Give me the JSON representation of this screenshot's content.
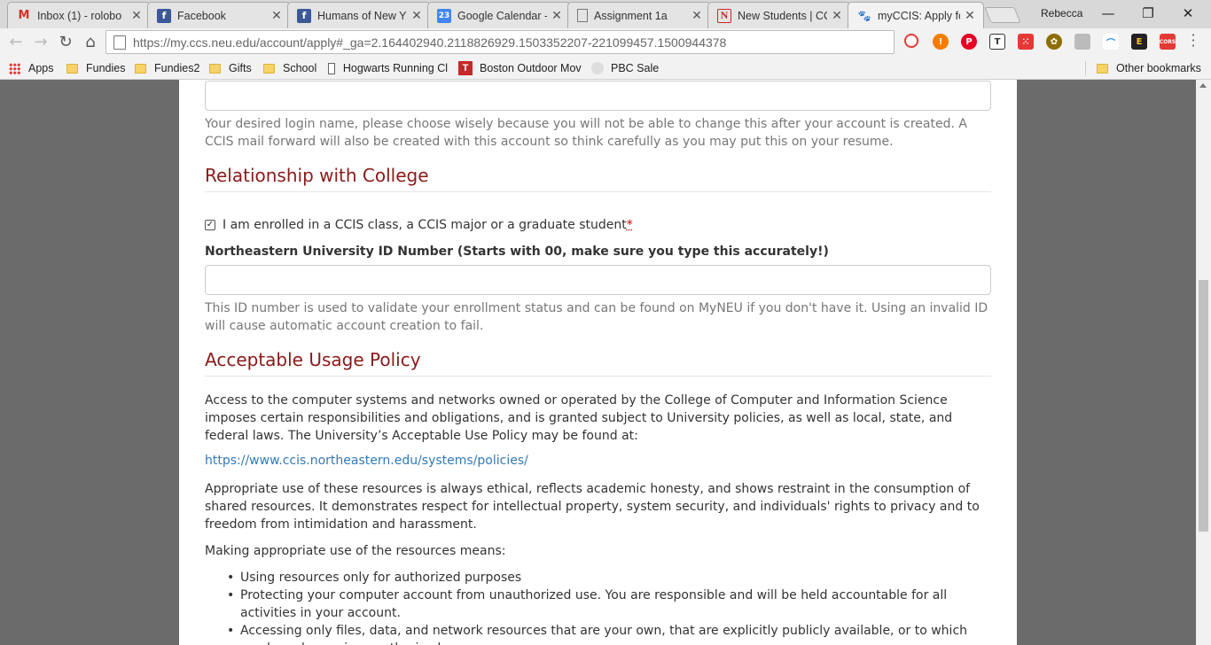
{
  "browser": {
    "tabs": [
      {
        "title": "Inbox (1) - rolobo",
        "icon": "gmail-icon",
        "color": "#d93025",
        "glyph": "M"
      },
      {
        "title": "Facebook",
        "icon": "facebook-icon",
        "color": "#3b5998",
        "glyph": "f"
      },
      {
        "title": "Humans of New Y",
        "icon": "facebook-icon",
        "color": "#3b5998",
        "glyph": "f"
      },
      {
        "title": "Google Calendar -",
        "icon": "calendar-icon",
        "color": "#4285f4",
        "glyph": "23"
      },
      {
        "title": "Assignment 1a",
        "icon": "document-icon",
        "color": "#ffffff",
        "glyph": ""
      },
      {
        "title": "New Students | CC",
        "icon": "northeastern-icon",
        "color": "#ffffff",
        "glyph": "N"
      },
      {
        "title": "myCCIS: Apply for",
        "icon": "paw-icon",
        "color": "#ffffff",
        "glyph": "🐾"
      }
    ],
    "profile_name": "Rebecca",
    "url": "https://my.ccs.neu.edu/account/apply#_ga=2.164402940.2118826929.1503352207-221099457.1500944378",
    "bookmarks": [
      {
        "label": "Apps",
        "kind": "apps"
      },
      {
        "label": "Fundies",
        "kind": "folder"
      },
      {
        "label": "Fundies2",
        "kind": "folder"
      },
      {
        "label": "Gifts",
        "kind": "folder"
      },
      {
        "label": "School",
        "kind": "folder"
      },
      {
        "label": "Hogwarts Running Cl",
        "kind": "page"
      },
      {
        "label": "Boston Outdoor Mov",
        "kind": "t"
      },
      {
        "label": "PBC Sale",
        "kind": "p"
      }
    ],
    "other_bookmarks": "Other bookmarks"
  },
  "form": {
    "login_help": "Your desired login name, please choose wisely because you will not be able to change this after your account is created. A CCIS mail forward will also be created with this account so think carefully as you may put this on your resume.",
    "relationship_heading": "Relationship with College",
    "enrolled_label": "I am enrolled in a CCIS class, a CCIS major or a graduate student",
    "required_marker": "*",
    "nuid_label": "Northeastern University ID Number (Starts with 00, make sure you type this accurately!)",
    "nuid_value": "",
    "nuid_help": "This ID number is used to validate your enrollment status and can be found on MyNEU if you don't have it. Using an invalid ID will cause automatic account creation to fail.",
    "aup_heading": "Acceptable Usage Policy",
    "aup_p1": "Access to the computer systems and networks owned or operated by the College of Computer and Information Science imposes certain responsibilities and obligations, and is granted subject to University policies, as well as local, state, and federal laws. The University’s Acceptable Use Policy may be found at:",
    "aup_link": "https://www.ccis.northeastern.edu/systems/policies/",
    "aup_p2": "Appropriate use of these resources is always ethical, reflects academic honesty, and shows restraint in the consumption of shared resources. It demonstrates respect for intellectual property, system security, and individuals' rights to privacy and to freedom from intimidation and harassment.",
    "aup_p3": "Making appropriate use of the resources means:",
    "aup_list": [
      "Using resources only for authorized purposes",
      "Protecting your computer account from unauthorized use. You are responsible and will be held accountable for all activities in your account.",
      "Accessing only files, data, and network resources that are your own, that are explicitly publicly available, or to which you have been given authorized access."
    ]
  }
}
